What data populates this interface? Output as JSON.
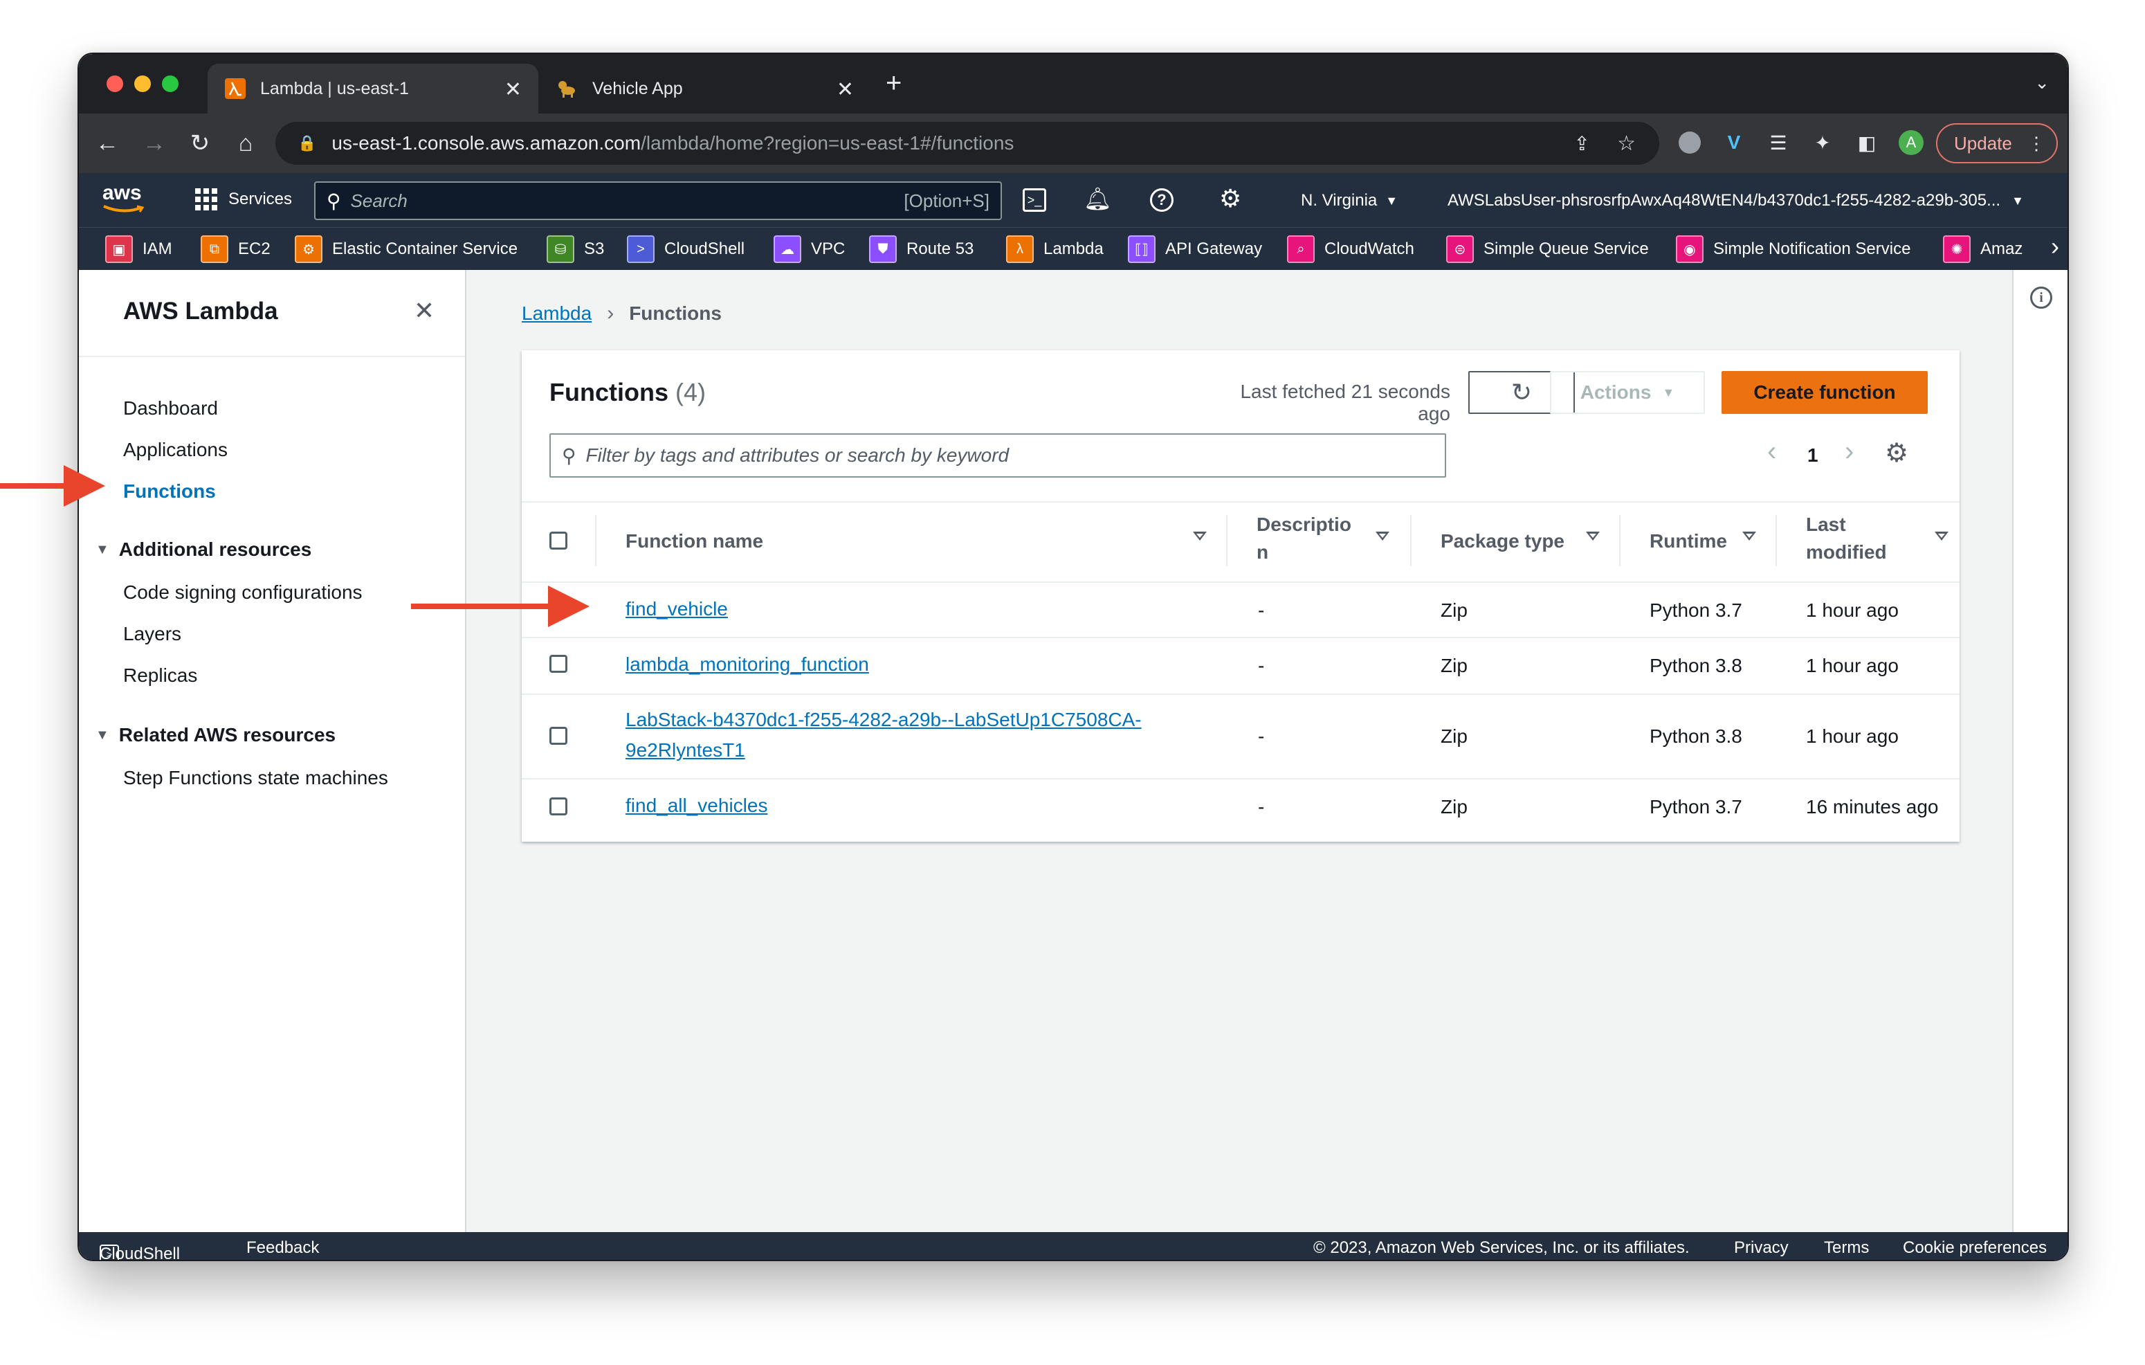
{
  "browser": {
    "tabs": [
      {
        "title": "Lambda | us-east-1",
        "icon": "lambda-favicon"
      },
      {
        "title": "Vehicle App",
        "icon": "dog-favicon"
      }
    ],
    "url_host": "us-east-1.console.aws.amazon.com",
    "url_path": "/lambda/home?region=us-east-1#/functions",
    "update_label": "Update",
    "profile_initial": "A"
  },
  "aws_header": {
    "logo": "aws",
    "services_label": "Services",
    "search_placeholder": "Search",
    "search_shortcut": "[Option+S]",
    "region": "N. Virginia",
    "account": "AWSLabsUser-phsrosrfpAwxAq48WtEN4/b4370dc1-f255-4282-a29b-305..."
  },
  "favorites": [
    {
      "label": "IAM",
      "color": "#dd344c"
    },
    {
      "label": "EC2",
      "color": "#ed7100"
    },
    {
      "label": "Elastic Container Service",
      "color": "#ed7100"
    },
    {
      "label": "S3",
      "color": "#3f8624"
    },
    {
      "label": "CloudShell",
      "color": "#4d5bd6"
    },
    {
      "label": "VPC",
      "color": "#8c4fff"
    },
    {
      "label": "Route 53",
      "color": "#8c4fff"
    },
    {
      "label": "Lambda",
      "color": "#ed7100"
    },
    {
      "label": "API Gateway",
      "color": "#8c4fff"
    },
    {
      "label": "CloudWatch",
      "color": "#e7157b"
    },
    {
      "label": "Simple Queue Service",
      "color": "#e7157b"
    },
    {
      "label": "Simple Notification Service",
      "color": "#e7157b"
    },
    {
      "label": "Amaz",
      "color": "#e7157b"
    }
  ],
  "sidebar": {
    "title": "AWS Lambda",
    "items": [
      "Dashboard",
      "Applications",
      "Functions"
    ],
    "active": "Functions",
    "additional_resources": {
      "heading": "Additional resources",
      "items": [
        "Code signing configurations",
        "Layers",
        "Replicas"
      ]
    },
    "related_resources": {
      "heading": "Related AWS resources",
      "items": [
        "Step Functions state machines"
      ]
    }
  },
  "breadcrumb": {
    "root": "Lambda",
    "current": "Functions"
  },
  "functions_panel": {
    "title": "Functions",
    "count": "(4)",
    "last_fetched": "Last fetched 21 seconds ago",
    "actions_label": "Actions",
    "create_label": "Create function",
    "filter_placeholder": "Filter by tags and attributes or search by keyword",
    "page_number": "1",
    "columns": [
      "Function name",
      "Descriptio",
      "n",
      "Package type",
      "Runtime",
      "Last",
      "modified"
    ],
    "rows": [
      {
        "name": "find_vehicle",
        "description": "-",
        "package": "Zip",
        "runtime": "Python 3.7",
        "modified": "1 hour ago"
      },
      {
        "name": "lambda_monitoring_function",
        "description": "-",
        "package": "Zip",
        "runtime": "Python 3.8",
        "modified": "1 hour ago"
      },
      {
        "name": "LabStack-b4370dc1-f255-4282-a29b--LabSetUp1C7508CA-",
        "name2": "9e2RlyntesT1",
        "description": "-",
        "package": "Zip",
        "runtime": "Python 3.8",
        "modified": "1 hour ago"
      },
      {
        "name": "find_all_vehicles",
        "description": "-",
        "package": "Zip",
        "runtime": "Python 3.7",
        "modified": "16 minutes ago"
      }
    ]
  },
  "footer": {
    "cloudshell": "CloudShell",
    "feedback": "Feedback",
    "copyright": "© 2023, Amazon Web Services, Inc. or its affiliates.",
    "privacy": "Privacy",
    "terms": "Terms",
    "cookies": "Cookie preferences"
  },
  "colors": {
    "accent_orange": "#ec7211",
    "link_blue": "#0073bb",
    "active_blue": "#0073bb",
    "annotation_red": "#e8452c"
  }
}
